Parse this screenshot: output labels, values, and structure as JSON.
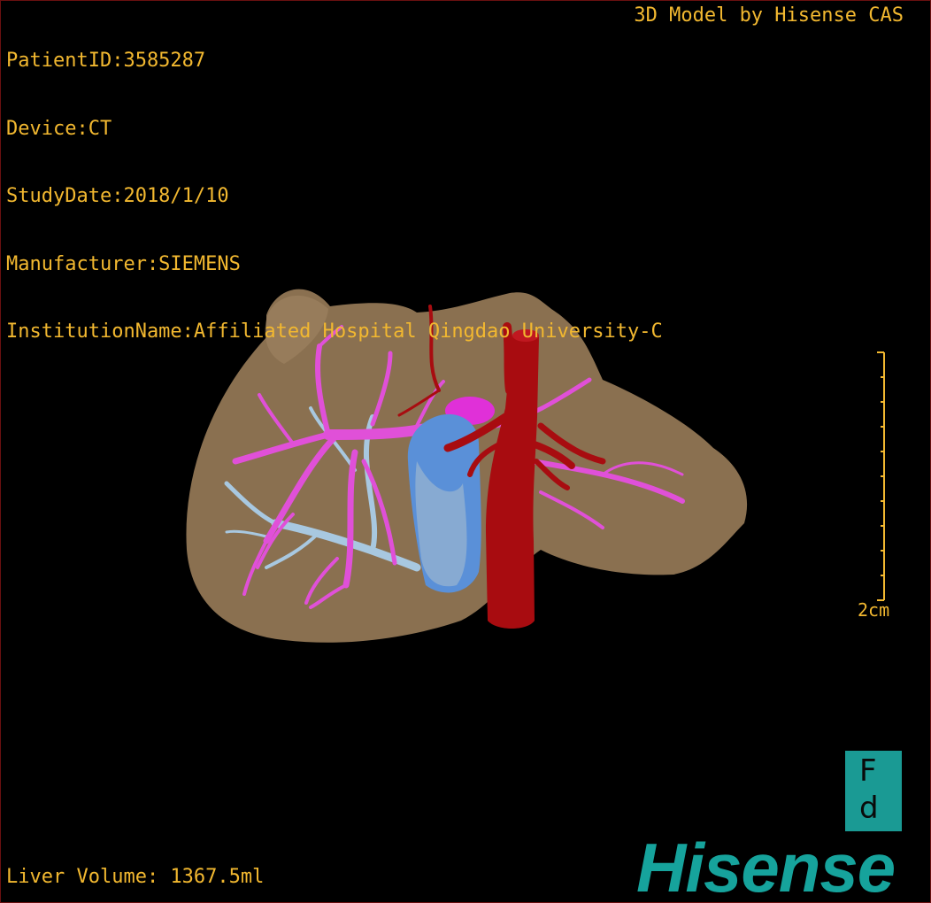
{
  "overlay": {
    "patient_id": "PatientID:3585287",
    "device": "Device:CT",
    "study_date": "StudyDate:2018/1/10",
    "manufacturer": "Manufacturer:SIEMENS",
    "institution": "InstitutionName:Affiliated Hospital Qingdao University-C",
    "app_title": "3D Model by Hisense CAS",
    "liver_volume": "Liver Volume: 1367.5ml"
  },
  "scale_bar": {
    "label": "2cm"
  },
  "orientation_marker": {
    "top_glyph": "F",
    "bottom_glyph": "d"
  },
  "brand": {
    "logo_text": "Hisense"
  },
  "colors": {
    "overlay_text": "#f2b830",
    "liver": "#8a7050",
    "portal_vein": "#e050d8",
    "hepatic_vein": "#a8c8e0",
    "ivc_artery": "#a80c10",
    "gallbladder": "#5a90d8",
    "brand": "#16a39c"
  }
}
